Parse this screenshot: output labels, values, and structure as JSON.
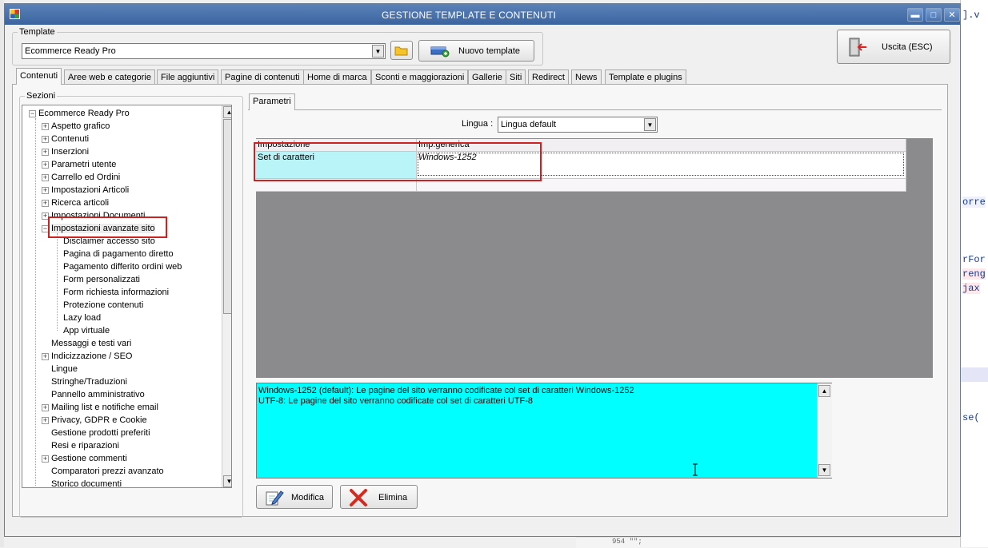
{
  "window": {
    "title": "GESTIONE TEMPLATE E CONTENUTI",
    "min_glyph": "▬",
    "max_glyph": "□",
    "close_glyph": "✕"
  },
  "template_group": {
    "legend": "Template",
    "selected": "Ecommerce Ready Pro",
    "new_template_label": "Nuovo template"
  },
  "exit_button": {
    "label": "Uscita (ESC)"
  },
  "tabs": [
    {
      "label": "Contenuti"
    },
    {
      "label": "Aree web e categorie"
    },
    {
      "label": "File aggiuntivi"
    },
    {
      "label": "Pagine di contenuti"
    },
    {
      "label": "Home di marca"
    },
    {
      "label": "Sconti e maggiorazioni"
    },
    {
      "label": "Gallerie"
    },
    {
      "label": "Siti"
    },
    {
      "label": "Redirect"
    },
    {
      "label": "News"
    },
    {
      "label": "Template e plugins"
    }
  ],
  "sections": {
    "legend": "Sezioni",
    "tree": [
      {
        "label": "Ecommerce Ready Pro",
        "exp": "−"
      },
      {
        "label": "Aspetto grafico",
        "exp": "+"
      },
      {
        "label": "Contenuti",
        "exp": "+"
      },
      {
        "label": "Inserzioni",
        "exp": "+"
      },
      {
        "label": "Parametri utente",
        "exp": "+"
      },
      {
        "label": "Carrello ed Ordini",
        "exp": "+"
      },
      {
        "label": "Impostazioni Articoli",
        "exp": "+"
      },
      {
        "label": "Ricerca articoli",
        "exp": "+"
      },
      {
        "label": "Impostazioni Documenti",
        "exp": "+"
      },
      {
        "label": "Impostazioni avanzate sito",
        "exp": "−"
      },
      {
        "label": "Disclaimer accesso sito",
        "exp": ""
      },
      {
        "label": "Pagina di pagamento diretto",
        "exp": ""
      },
      {
        "label": "Pagamento differito ordini web",
        "exp": ""
      },
      {
        "label": "Form personalizzati",
        "exp": ""
      },
      {
        "label": "Form richiesta informazioni",
        "exp": ""
      },
      {
        "label": "Protezione contenuti",
        "exp": ""
      },
      {
        "label": "Lazy load",
        "exp": ""
      },
      {
        "label": "App virtuale",
        "exp": ""
      },
      {
        "label": "Messaggi e testi vari",
        "exp": ""
      },
      {
        "label": "Indicizzazione / SEO",
        "exp": "+"
      },
      {
        "label": "Lingue",
        "exp": ""
      },
      {
        "label": "Stringhe/Traduzioni",
        "exp": ""
      },
      {
        "label": "Pannello amministrativo",
        "exp": ""
      },
      {
        "label": "Mailing list e notifiche email",
        "exp": "+"
      },
      {
        "label": "Privacy, GDPR e Cookie",
        "exp": "+"
      },
      {
        "label": "Gestione prodotti preferiti",
        "exp": ""
      },
      {
        "label": "Resi e riparazioni",
        "exp": ""
      },
      {
        "label": "Gestione commenti",
        "exp": "+"
      },
      {
        "label": "Comparatori prezzi avanzato",
        "exp": ""
      },
      {
        "label": "Storico documenti",
        "exp": ""
      }
    ]
  },
  "params": {
    "tab_label": "Parametri",
    "lingua_label": "Lingua :",
    "lingua_value": "Lingua default",
    "grid": {
      "headers": [
        "Impostazione",
        "Imp.generica"
      ],
      "rows": [
        [
          "Set di caratteri",
          "Windows-1252"
        ]
      ]
    },
    "description": [
      "Windows-1252 (default): Le pagine del sito verranno codificate col set di caratteri Windows-1252",
      "UTF-8: Le pagine del sito verranno codificate col set di caratteri UTF-8"
    ],
    "modify_label": "Modifica",
    "delete_label": "Elimina"
  },
  "background_editor": {
    "lines": [
      "].v",
      "orre",
      "rFor",
      "reng",
      "jax",
      "se("
    ],
    "bottom_text": "954       \"\";"
  },
  "colors": {
    "title_bar": "#3b64a0",
    "description_bg": "#00ffff",
    "selected_cell_bg": "#b8f4f8",
    "grid_bg": "#8b8a8d",
    "highlight_box": "#cc2222"
  }
}
